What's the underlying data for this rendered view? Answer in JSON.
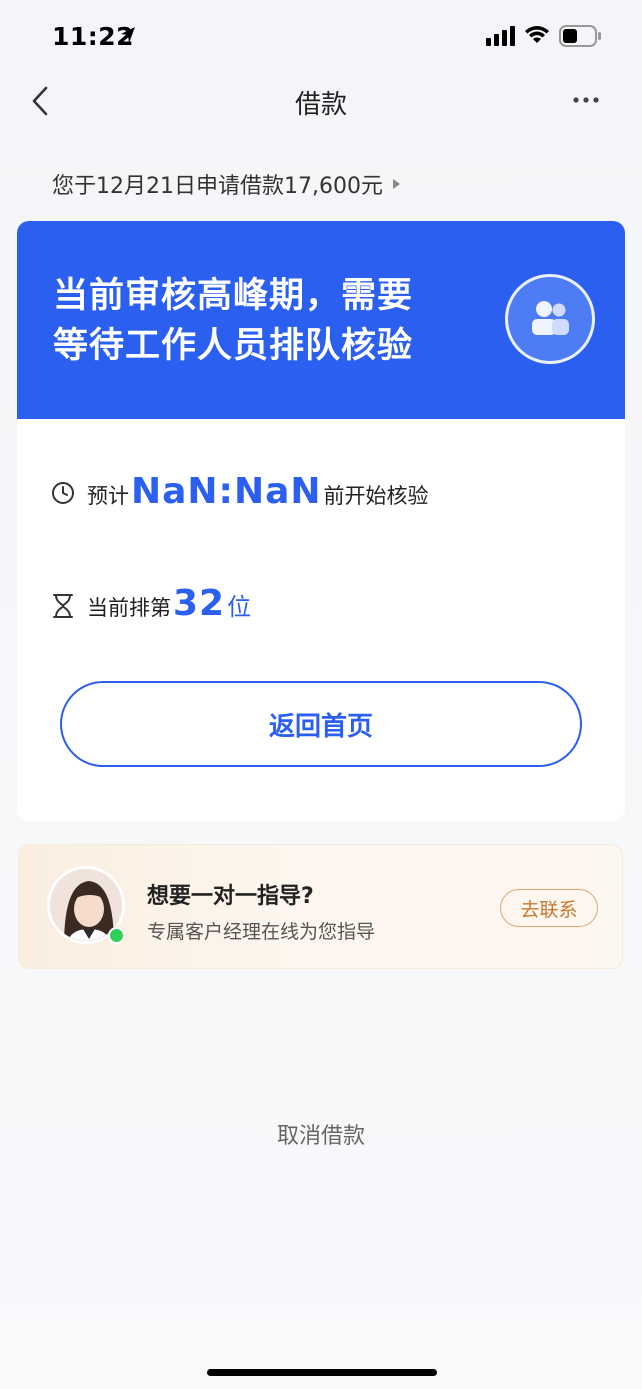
{
  "status_bar": {
    "time": "11:22"
  },
  "nav": {
    "title": "借款"
  },
  "application": {
    "summary": "您于12月21日申请借款17,600元"
  },
  "card": {
    "headline_line1": "当前审核高峰期，需要",
    "headline_line2": "等待工作人员排队核验",
    "time_prefix": "预计",
    "time_value": "NaN:NaN",
    "time_suffix": "前开始核验",
    "queue_prefix": "当前排第",
    "queue_value": "32",
    "queue_suffix": "位",
    "home_button": "返回首页"
  },
  "guide": {
    "title": "想要一对一指导?",
    "subtitle": "专属客户经理在线为您指导",
    "contact_button": "去联系"
  },
  "cancel_label": "取消借款",
  "colors": {
    "primary": "#2a5ff0",
    "accent": "#c8772e",
    "online": "#2ed15a"
  },
  "icons": [
    "location-arrow-icon",
    "signal-icon",
    "wifi-icon",
    "battery-icon",
    "back-icon",
    "more-icon",
    "users-icon",
    "clock-icon",
    "hourglass-icon",
    "chevron-right-icon"
  ]
}
